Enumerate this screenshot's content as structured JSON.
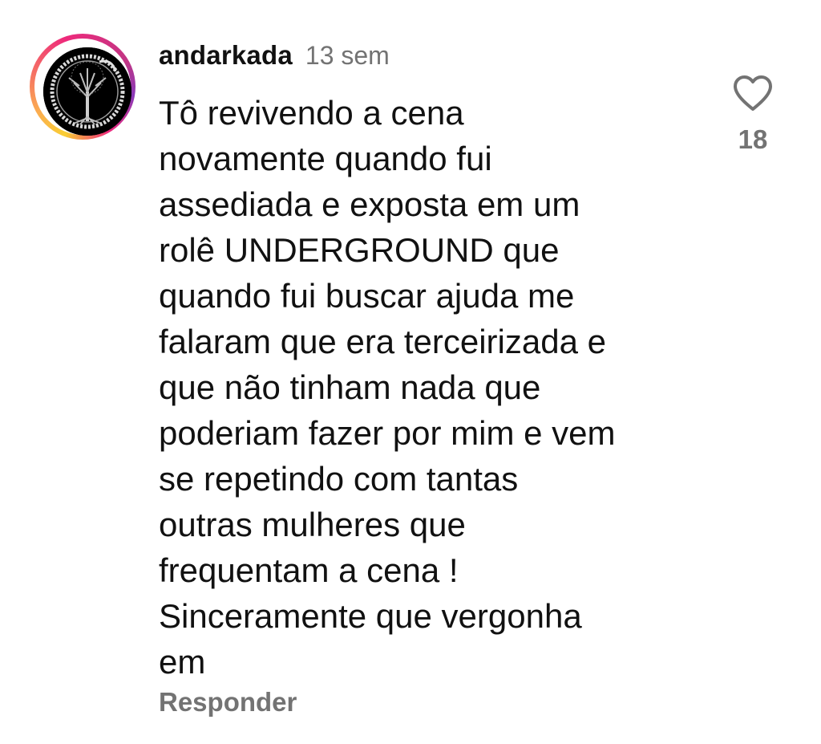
{
  "comment": {
    "username": "andarkada",
    "time": "13 sem",
    "lines": [
      "Tô revivendo a cena",
      "novamente quando fui",
      "assediada e exposta em um",
      "rolê UNDERGROUND que",
      "quando fui buscar ajuda me",
      "falaram que era terceirizada e",
      "que não tinham nada que",
      "poderiam fazer por mim e vem",
      "se repetindo com tantas",
      "outras mulheres que",
      "frequentam a cena !",
      "Sinceramente que vergonha",
      "em"
    ],
    "reply_label": "Responder",
    "like_count": "18",
    "like_icon": "heart-outline-icon",
    "avatar_icon": "tree-of-life-icon"
  },
  "colors": {
    "text": "#111111",
    "muted": "#737373",
    "background": "#ffffff"
  }
}
